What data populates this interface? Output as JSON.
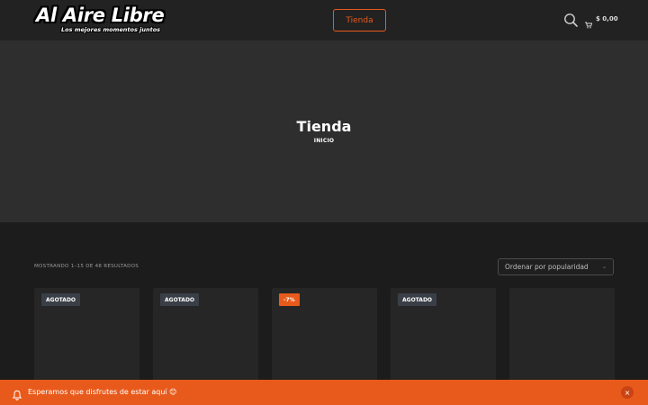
{
  "header": {
    "logo_title": "Al Aire Libre",
    "logo_tagline": "Los mejores momentos juntos",
    "nav_button": "Tienda",
    "search_icon": "search-icon",
    "cart_icon": "cart-icon",
    "cart_total": "$ 0,00"
  },
  "hero": {
    "title": "Tienda",
    "breadcrumb": "INICIO"
  },
  "shop": {
    "result_count": "MOSTRANDO 1–15 DE 48 RESULTADOS",
    "sort_selected": "Ordenar por popularidad"
  },
  "products": [
    {
      "badge": "AGOTADO",
      "badge_type": "out"
    },
    {
      "badge": "AGOTADO",
      "badge_type": "out"
    },
    {
      "badge": "-7%",
      "badge_type": "sale"
    },
    {
      "badge": "AGOTADO",
      "badge_type": "out"
    },
    {
      "badge": "",
      "badge_type": "none"
    }
  ],
  "notice": {
    "text": "Esperamos que disfrutes de estar aquí 😊",
    "bell_icon": "bell-icon",
    "close_label": "×"
  },
  "colors": {
    "accent": "#e85a1b",
    "header_bg": "#222222",
    "hero_bg": "#2e2e2e",
    "page_bg": "#1c1c1c"
  }
}
